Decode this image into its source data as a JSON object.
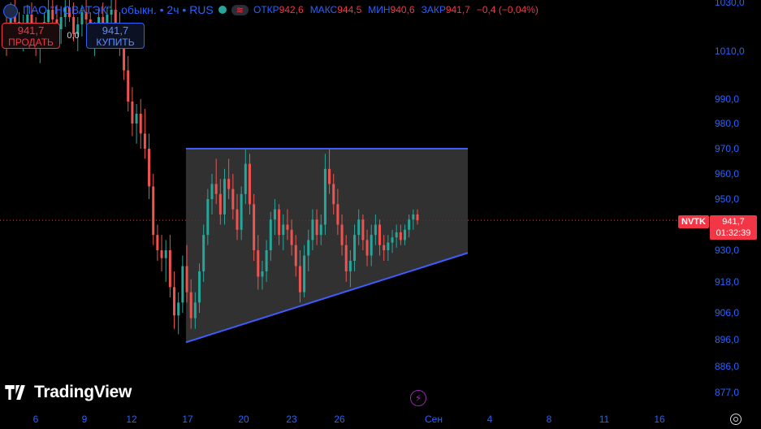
{
  "legend": {
    "title": "ПАО \"НОВАТЭК\" - обыкн. • 2ч • RUS",
    "pill": "≋",
    "open_label": "ОТКР",
    "open_value": "942,6",
    "high_label": "МАКС",
    "high_value": "944,5",
    "low_label": "МИН",
    "low_value": "940,6",
    "close_label": "ЗАКР",
    "close_value": "941,7",
    "change": "−0,4 (−0,04%)"
  },
  "trade": {
    "sell_price": "941,7",
    "sell_label": "ПРОДАТЬ",
    "spread": "0,0",
    "buy_price": "941,7",
    "buy_label": "КУПИТЬ"
  },
  "price_tag": {
    "symbol": "NVTK",
    "price": "941,7",
    "countdown": "01:32:39"
  },
  "brand": "TradingView",
  "colors": {
    "up": "#26a69a",
    "down": "#ef5350",
    "triangle": "#3c5eff",
    "fill": "#3a3a3a",
    "axis_text": "#2962ff"
  },
  "icons": [
    "symbol-icon",
    "lightning-icon",
    "settings-icon",
    "tradingview-logo-icon"
  ],
  "chart_data": {
    "type": "candlestick",
    "price_axis_ticks": [
      "1030,0",
      "1010,0",
      "990,0",
      "980,0",
      "970,0",
      "960,0",
      "950,0",
      "930,0",
      "918,0",
      "906,0",
      "896,0",
      "886,0",
      "877,0"
    ],
    "time_axis_ticks": [
      "6",
      "9",
      "12",
      "17",
      "20",
      "23",
      "26",
      "Сен",
      "4",
      "8",
      "11",
      "16"
    ],
    "last_price": 941.7,
    "pattern": {
      "type": "ascending triangle",
      "upper_line": {
        "start": [
          "17",
          970.0
        ],
        "end": [
          "3",
          970.0
        ]
      },
      "lower_line": {
        "start": [
          "17",
          895.0
        ],
        "end": [
          "3",
          929.0
        ]
      }
    },
    "ohlc": [
      [
        1020,
        1027,
        1008,
        1015
      ],
      [
        1015,
        1030,
        1012,
        1026
      ],
      [
        1026,
        1031,
        1018,
        1022
      ],
      [
        1022,
        1026,
        1012,
        1016
      ],
      [
        1016,
        1025,
        1010,
        1021
      ],
      [
        1021,
        1029,
        1017,
        1025
      ],
      [
        1025,
        1030,
        1016,
        1018
      ],
      [
        1018,
        1024,
        1008,
        1012
      ],
      [
        1012,
        1020,
        1005,
        1016
      ],
      [
        1016,
        1026,
        1012,
        1022
      ],
      [
        1022,
        1031,
        1019,
        1027
      ],
      [
        1027,
        1031,
        1020,
        1023
      ],
      [
        1023,
        1029,
        1016,
        1019
      ],
      [
        1019,
        1027,
        1013,
        1024
      ],
      [
        1024,
        1031,
        1020,
        1028
      ],
      [
        1028,
        1031,
        1022,
        1024
      ],
      [
        1024,
        1030,
        1014,
        1017
      ],
      [
        1017,
        1024,
        1010,
        1021
      ],
      [
        1021,
        1029,
        1016,
        1026
      ],
      [
        1026,
        1031,
        1021,
        1023
      ],
      [
        1023,
        1026,
        1012,
        1014
      ],
      [
        1014,
        1022,
        1008,
        1019
      ],
      [
        1019,
        1028,
        1015,
        1024
      ],
      [
        1024,
        1030,
        1018,
        1020
      ],
      [
        1020,
        1028,
        1015,
        1025
      ],
      [
        1025,
        1031,
        1021,
        1027
      ],
      [
        1027,
        1031,
        1018,
        1021
      ],
      [
        1021,
        1026,
        1008,
        1011
      ],
      [
        1011,
        1017,
        998,
        1002
      ],
      [
        1002,
        1008,
        985,
        989
      ],
      [
        989,
        995,
        975,
        980
      ],
      [
        980,
        988,
        972,
        984
      ],
      [
        984,
        990,
        970,
        976
      ],
      [
        976,
        986,
        966,
        970
      ],
      [
        970,
        976,
        950,
        955
      ],
      [
        955,
        960,
        932,
        936
      ],
      [
        936,
        940,
        926,
        930
      ],
      [
        930,
        936,
        922,
        927
      ],
      [
        927,
        934,
        918,
        930
      ],
      [
        930,
        936,
        912,
        916
      ],
      [
        916,
        922,
        900,
        905
      ],
      [
        905,
        914,
        898,
        910
      ],
      [
        910,
        928,
        906,
        924
      ],
      [
        924,
        932,
        910,
        914
      ],
      [
        914,
        919,
        900,
        904
      ],
      [
        904,
        914,
        900,
        910
      ],
      [
        910,
        925,
        906,
        922
      ],
      [
        922,
        940,
        918,
        936
      ],
      [
        936,
        954,
        932,
        950
      ],
      [
        950,
        960,
        944,
        956
      ],
      [
        956,
        966,
        948,
        952
      ],
      [
        952,
        958,
        940,
        944
      ],
      [
        944,
        962,
        940,
        958
      ],
      [
        958,
        966,
        950,
        954
      ],
      [
        954,
        960,
        942,
        946
      ],
      [
        946,
        952,
        934,
        938
      ],
      [
        938,
        955,
        934,
        952
      ],
      [
        952,
        970,
        948,
        964
      ],
      [
        964,
        968,
        944,
        948
      ],
      [
        948,
        952,
        926,
        930
      ],
      [
        930,
        936,
        915,
        920
      ],
      [
        920,
        926,
        915,
        922
      ],
      [
        922,
        934,
        918,
        930
      ],
      [
        930,
        945,
        926,
        942
      ],
      [
        942,
        950,
        936,
        946
      ],
      [
        946,
        948,
        932,
        936
      ],
      [
        936,
        944,
        930,
        940
      ],
      [
        940,
        946,
        934,
        938
      ],
      [
        938,
        942,
        928,
        932
      ],
      [
        932,
        936,
        920,
        924
      ],
      [
        924,
        930,
        910,
        914
      ],
      [
        914,
        932,
        912,
        928
      ],
      [
        928,
        938,
        922,
        934
      ],
      [
        934,
        946,
        930,
        942
      ],
      [
        942,
        946,
        932,
        936
      ],
      [
        936,
        944,
        932,
        940
      ],
      [
        940,
        968,
        936,
        962
      ],
      [
        962,
        970,
        952,
        956
      ],
      [
        956,
        960,
        944,
        948
      ],
      [
        948,
        954,
        936,
        940
      ],
      [
        940,
        944,
        928,
        932
      ],
      [
        932,
        936,
        918,
        922
      ],
      [
        922,
        930,
        916,
        926
      ],
      [
        926,
        940,
        922,
        936
      ],
      [
        936,
        946,
        932,
        942
      ],
      [
        942,
        944,
        930,
        934
      ],
      [
        934,
        938,
        924,
        928
      ],
      [
        928,
        940,
        924,
        936
      ],
      [
        936,
        944,
        932,
        940
      ],
      [
        940,
        942,
        928,
        932
      ],
      [
        932,
        936,
        926,
        930
      ],
      [
        930,
        936,
        926,
        933
      ],
      [
        933,
        938,
        929,
        935
      ],
      [
        935,
        940,
        931,
        937
      ],
      [
        937,
        940,
        932,
        934
      ],
      [
        934,
        940,
        932,
        938
      ],
      [
        938,
        944,
        935,
        942
      ],
      [
        942,
        946,
        938,
        944
      ],
      [
        944,
        946,
        940,
        941.7
      ]
    ]
  }
}
